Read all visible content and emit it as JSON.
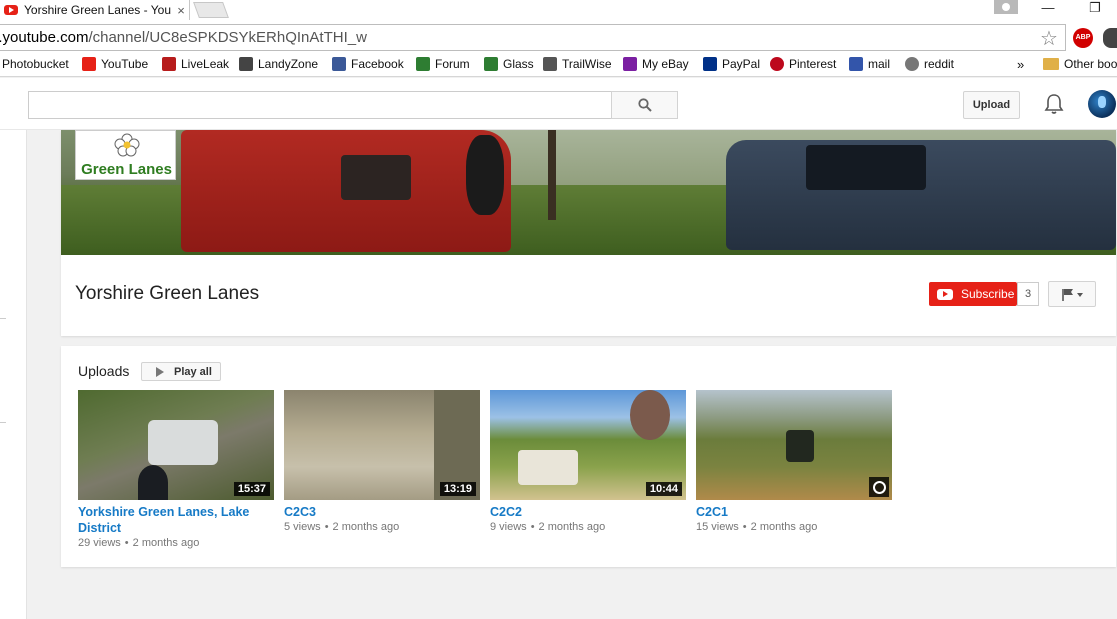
{
  "browser": {
    "tab_title": "Yorshire Green Lanes - You",
    "tab_close": "×",
    "url_host": "y.youtube.com",
    "url_path": "/channel/UC8eSPKDSYkERhQInAtTHI_w",
    "bookmarks": [
      {
        "label": "Photobucket",
        "color": "#2a5aa8"
      },
      {
        "label": "YouTube",
        "color": "#e62117"
      },
      {
        "label": "LiveLeak",
        "color": "#b71c1c"
      },
      {
        "label": "LandyZone",
        "color": "#444444"
      },
      {
        "label": "Facebook",
        "color": "#3b5998"
      },
      {
        "label": "Forum",
        "color": "#2e7d32"
      },
      {
        "label": "Glass",
        "color": "#2e7d32"
      },
      {
        "label": "TrailWise",
        "color": "#555555"
      },
      {
        "label": "My eBay",
        "color": "#7b1fa2"
      },
      {
        "label": "PayPal",
        "color": "#003087"
      },
      {
        "label": "Pinterest",
        "color": "#bd081c"
      },
      {
        "label": "mail",
        "color": "#3355aa"
      },
      {
        "label": "reddit",
        "color": "#555555"
      }
    ],
    "more_bookmarks": "»",
    "other_bookmarks": "Other boo"
  },
  "masthead": {
    "upload_label": "Upload"
  },
  "channel": {
    "logo_text": "Green Lanes",
    "name": "Yorshire Green Lanes",
    "subscribe_label": "Subscribe",
    "subscriber_count": "3"
  },
  "uploads": {
    "section_title": "Uploads",
    "play_all_label": "Play all",
    "videos": [
      {
        "title": "Yorkshire Green Lanes, Lake District",
        "duration": "15:37",
        "views": "29 views",
        "age": "2 months ago"
      },
      {
        "title": "C2C3",
        "duration": "13:19",
        "views": "5 views",
        "age": "2 months ago"
      },
      {
        "title": "C2C2",
        "duration": "10:44",
        "views": "9 views",
        "age": "2 months ago"
      },
      {
        "title": "C2C1",
        "duration": "",
        "views": "15 views",
        "age": "2 months ago"
      }
    ]
  },
  "colors": {
    "accent": "#e62117",
    "link": "#167ac6"
  }
}
